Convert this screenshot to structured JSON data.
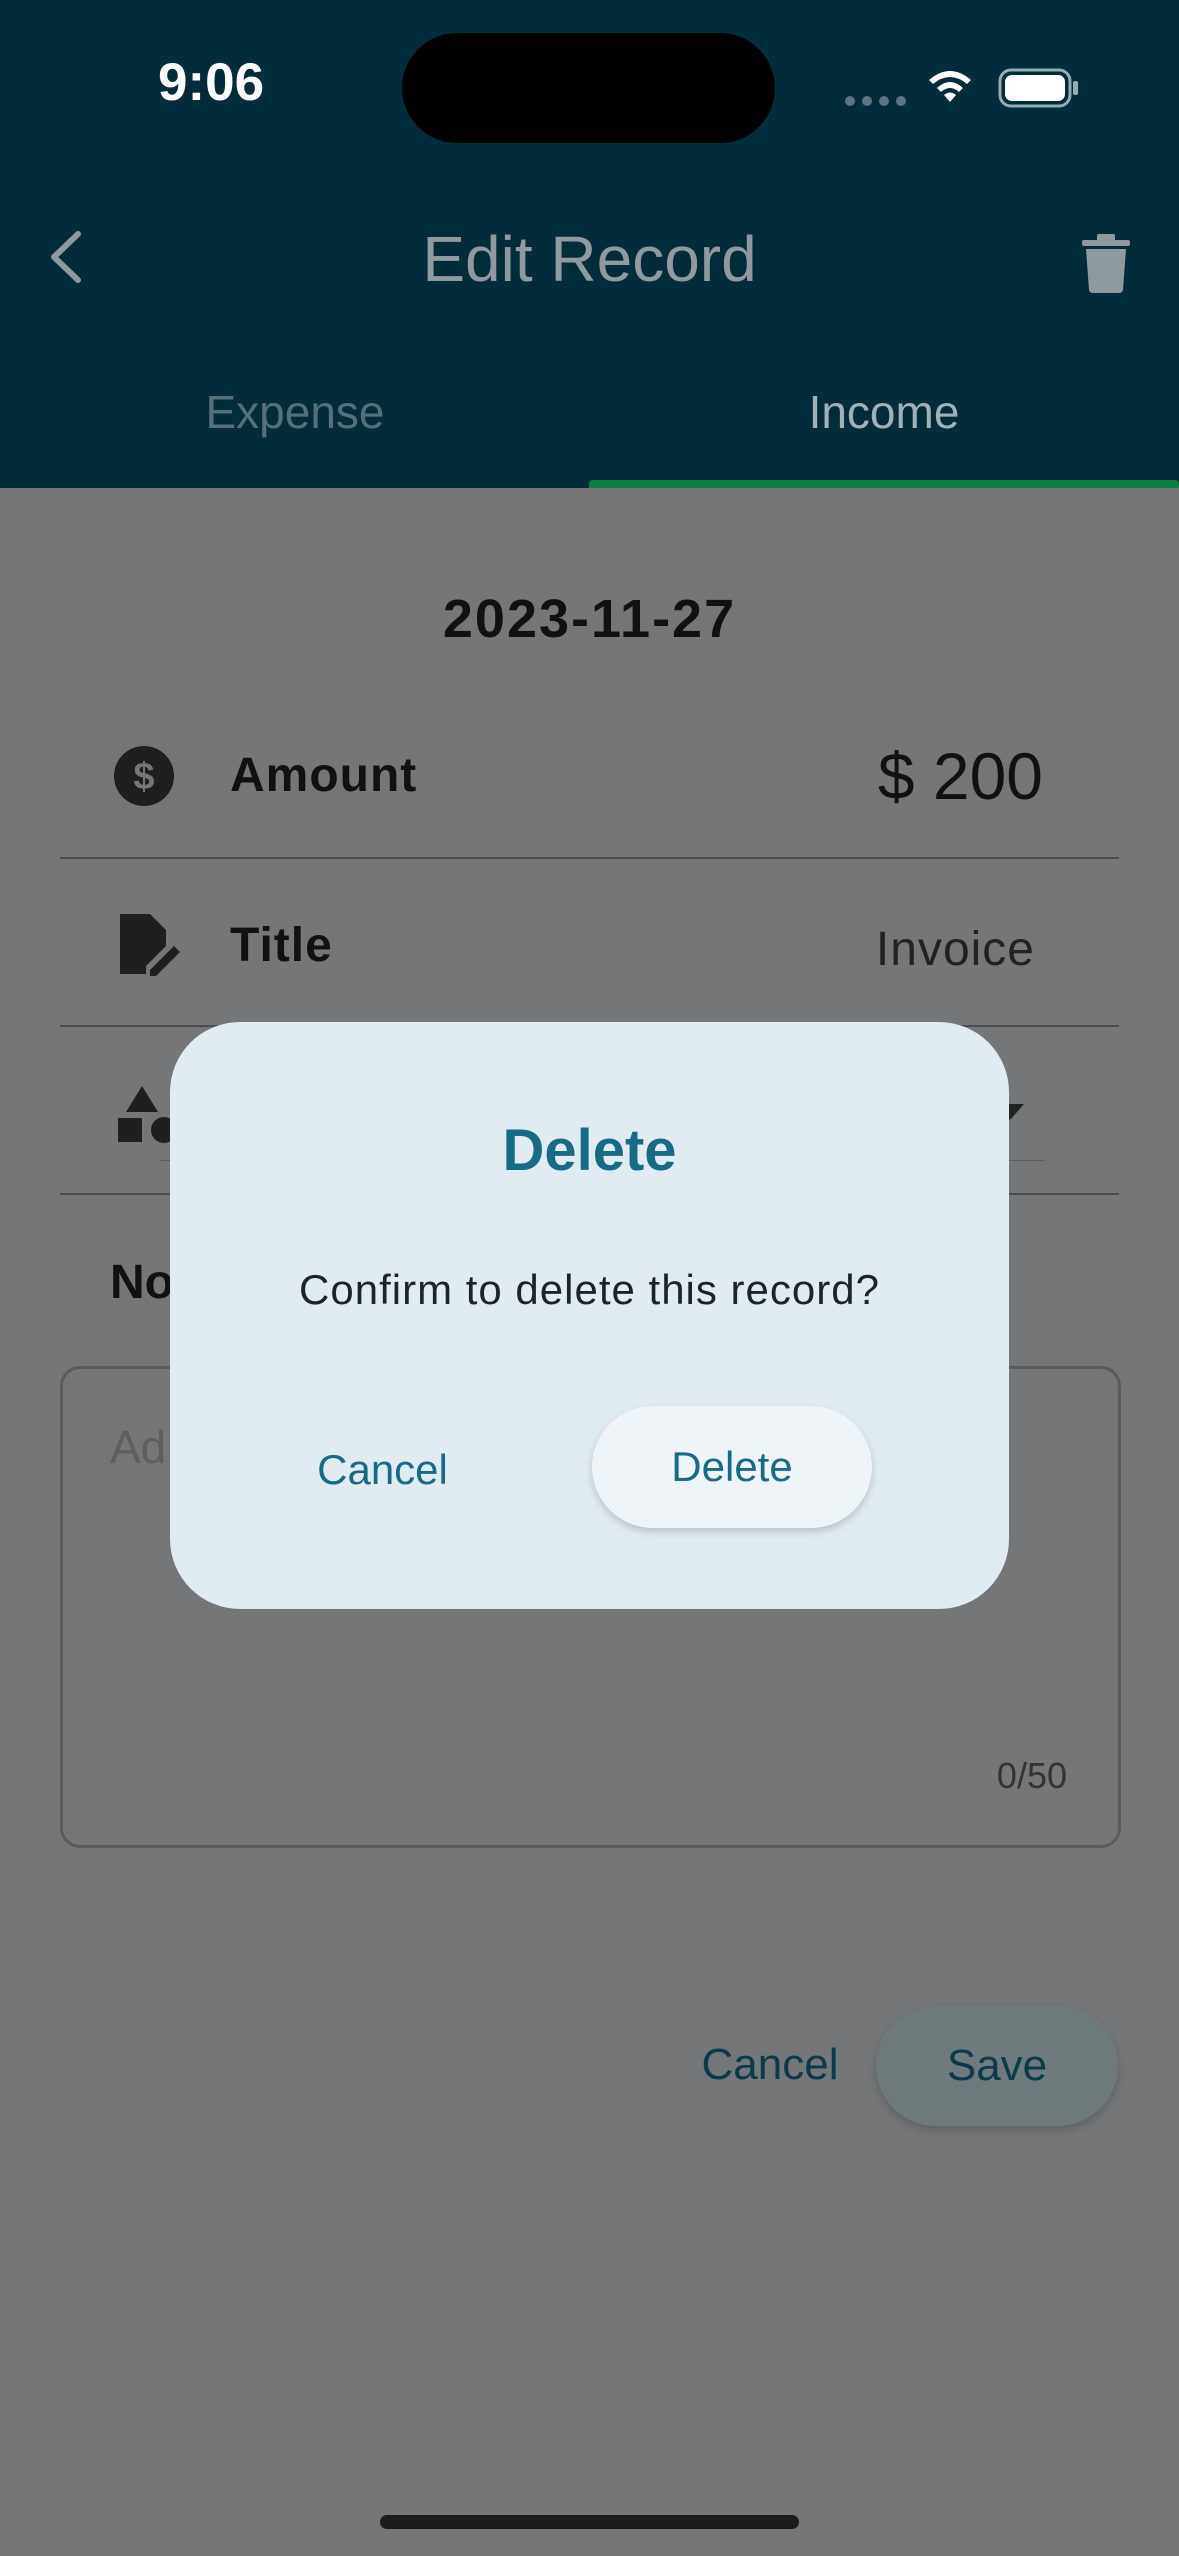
{
  "status_bar": {
    "time": "9:06"
  },
  "header": {
    "title": "Edit Record",
    "back_icon": "chevron-left-icon",
    "delete_icon": "trash-icon"
  },
  "tabs": [
    {
      "label": "Expense",
      "selected": false
    },
    {
      "label": "Income",
      "selected": true
    }
  ],
  "form": {
    "date": "2023-11-27",
    "amount": {
      "label": "Amount",
      "value": "$ 200",
      "icon": "dollar-circle-icon"
    },
    "title": {
      "label": "Title",
      "value": "Invoice",
      "icon": "file-edit-icon"
    },
    "category": {
      "icon": "shapes-icon"
    },
    "notes": {
      "label_partial": "No",
      "placeholder_partial": "Ad",
      "char_count": "0/50"
    }
  },
  "actions": {
    "cancel_label": "Cancel",
    "save_label": "Save"
  },
  "dialog": {
    "title": "Delete",
    "message": "Confirm to delete this record?",
    "cancel_label": "Cancel",
    "confirm_label": "Delete"
  },
  "colors": {
    "header_bg": "#002d39",
    "overlay_bg": "#757677",
    "accent": "#166b86",
    "tab_indicator": "#0c7f43",
    "dialog_bg": "#e1ecf2"
  }
}
